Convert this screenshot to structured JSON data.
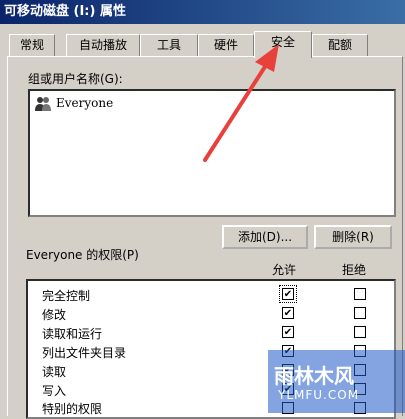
{
  "window": {
    "title": "可移动磁盘 (I:) 属性"
  },
  "tabs": [
    {
      "label": "常规"
    },
    {
      "label": "自动播放"
    },
    {
      "label": "工具"
    },
    {
      "label": "硬件"
    },
    {
      "label": "安全",
      "active": true
    },
    {
      "label": "配额"
    }
  ],
  "groups": {
    "label": "组或用户名称(G):",
    "items": [
      {
        "name": "Everyone",
        "icon": "users-icon"
      }
    ]
  },
  "buttons": {
    "add": "添加(D)...",
    "remove": "删除(R)"
  },
  "permissions": {
    "label": "Everyone 的权限(P)",
    "col_allow": "允许",
    "col_deny": "拒绝",
    "rows": [
      {
        "name": "完全控制",
        "allow": true,
        "deny": false
      },
      {
        "name": "修改",
        "allow": true,
        "deny": false
      },
      {
        "name": "读取和运行",
        "allow": true,
        "deny": false
      },
      {
        "name": "列出文件夹目录",
        "allow": true,
        "deny": false
      },
      {
        "name": "读取",
        "allow": true,
        "deny": false
      },
      {
        "name": "写入",
        "allow": true,
        "deny": false
      },
      {
        "name": "特别的权限",
        "allow": false,
        "deny": false
      }
    ]
  },
  "watermark": {
    "main": "雨林木风",
    "sub": "YLMFU.COM"
  },
  "colors": {
    "titlebar": "#0a246a",
    "annotation_arrow": "#e8403a",
    "dialog_bg": "#d4d0c8"
  }
}
